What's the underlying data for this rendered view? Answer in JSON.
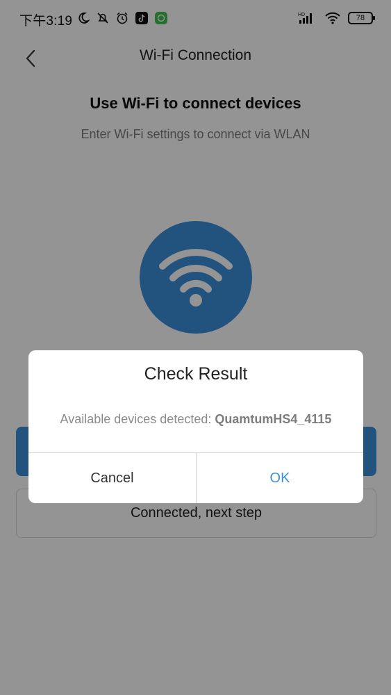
{
  "status_bar": {
    "time": "下午3:19",
    "battery": "78",
    "network": "HD",
    "icons": [
      "moon-icon",
      "mute-icon",
      "alarm-icon",
      "tiktok-app-icon",
      "green-app-icon",
      "signal-icon",
      "wifi-icon",
      "battery-icon"
    ]
  },
  "header": {
    "title": "Wi-Fi Connection",
    "back_icon": "chevron-left-icon"
  },
  "main": {
    "title": "Use Wi-Fi to connect devices",
    "subtitle": "Enter Wi-Fi settings to connect via WLAN",
    "wifi_icon": "wifi-icon",
    "secondary_button": "Connected, next step"
  },
  "dialog": {
    "title": "Check Result",
    "message_prefix": "Available devices detected: ",
    "device_name": "QuamtumHS4_4115",
    "cancel_label": "Cancel",
    "ok_label": "OK"
  },
  "colors": {
    "accent": "#3a8fd9",
    "overlay": "rgba(0,0,0,0.42)"
  }
}
